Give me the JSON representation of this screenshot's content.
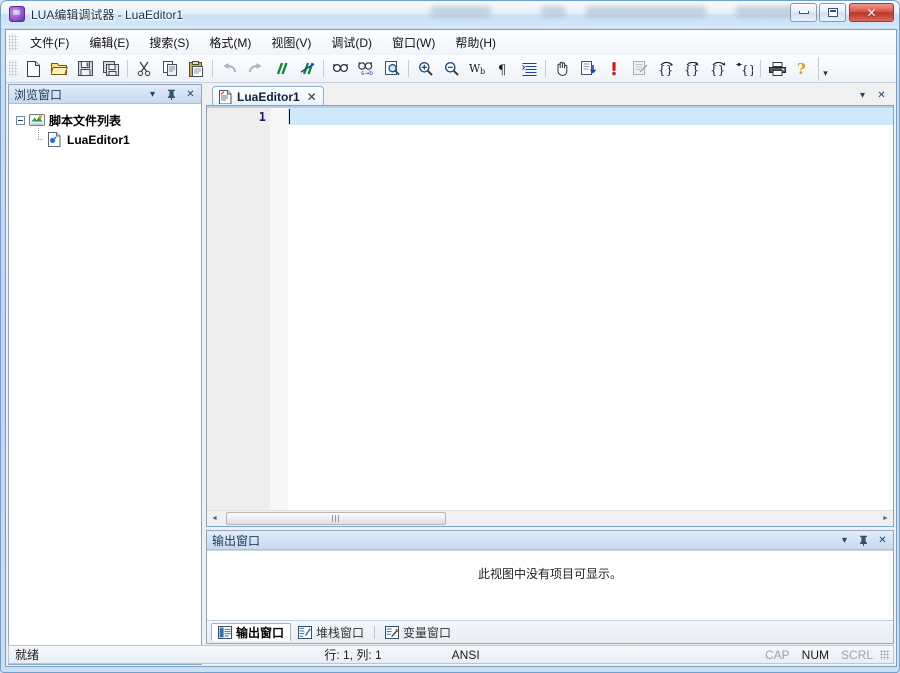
{
  "window": {
    "title": "LUA编辑调试器 - LuaEditor1",
    "app_icon": "lua-app-icon",
    "minimize_label": "",
    "maximize_label": "",
    "close_label": "✕"
  },
  "menubar": {
    "items": [
      {
        "label": "文件(F)",
        "name": "menu-file"
      },
      {
        "label": "编辑(E)",
        "name": "menu-edit"
      },
      {
        "label": "搜索(S)",
        "name": "menu-search"
      },
      {
        "label": "格式(M)",
        "name": "menu-format"
      },
      {
        "label": "视图(V)",
        "name": "menu-view"
      },
      {
        "label": "调试(D)",
        "name": "menu-debug"
      },
      {
        "label": "窗口(W)",
        "name": "menu-window"
      },
      {
        "label": "帮助(H)",
        "name": "menu-help"
      }
    ]
  },
  "toolbar": {
    "overflow_label": "▾",
    "buttons": [
      {
        "icon": "new-file-icon"
      },
      {
        "icon": "open-folder-icon"
      },
      {
        "icon": "save-icon"
      },
      {
        "icon": "save-all-icon"
      },
      {
        "icon": "separator"
      },
      {
        "icon": "cut-icon"
      },
      {
        "icon": "copy-icon"
      },
      {
        "icon": "paste-icon"
      },
      {
        "icon": "separator"
      },
      {
        "icon": "undo-icon"
      },
      {
        "icon": "redo-icon"
      },
      {
        "icon": "comment-icon"
      },
      {
        "icon": "uncomment-icon"
      },
      {
        "icon": "separator"
      },
      {
        "icon": "find-icon"
      },
      {
        "icon": "find-next-icon"
      },
      {
        "icon": "find-in-files-icon"
      },
      {
        "icon": "separator"
      },
      {
        "icon": "zoom-in-icon"
      },
      {
        "icon": "zoom-out-icon"
      },
      {
        "icon": "word-wrap-icon"
      },
      {
        "icon": "paragraph-marks-icon"
      },
      {
        "icon": "indent-guides-icon"
      },
      {
        "icon": "separator"
      },
      {
        "icon": "hand-pan-icon"
      },
      {
        "icon": "run-script-icon"
      },
      {
        "icon": "breakpoint-icon"
      },
      {
        "icon": "clear-breakpoints-icon"
      },
      {
        "icon": "step-over-icon"
      },
      {
        "icon": "step-into-icon"
      },
      {
        "icon": "step-out-icon"
      },
      {
        "icon": "run-to-cursor-icon"
      },
      {
        "icon": "separator"
      },
      {
        "icon": "print-icon"
      },
      {
        "icon": "help-icon"
      }
    ]
  },
  "browser_panel": {
    "title": "浏览窗口",
    "caption_buttons": [
      {
        "label": "▾",
        "name": "browser-panel-menu-button"
      },
      {
        "label": "⊥",
        "name": "browser-panel-pin-button"
      },
      {
        "label": "✕",
        "name": "browser-panel-close-button"
      }
    ],
    "tree": {
      "root": {
        "label": "脚本文件列表",
        "icon": "script-list-icon"
      },
      "children": [
        {
          "label": "LuaEditor1",
          "icon": "lua-file-icon"
        }
      ]
    }
  },
  "editor": {
    "tabs": [
      {
        "label": "LuaEditor1",
        "icon": "lua-document-icon",
        "close_label": "✕",
        "active": true
      }
    ],
    "tabstrip_buttons": [
      {
        "label": "▾",
        "name": "tabstrip-dropdown-button"
      },
      {
        "label": "✕",
        "name": "tabstrip-close-button"
      }
    ],
    "line_numbers": [
      "1"
    ],
    "content_lines": [
      ""
    ],
    "hscroll": {
      "left_arrow": "◄",
      "right_arrow": "►"
    }
  },
  "output_panel": {
    "title": "输出窗口",
    "caption_buttons": [
      {
        "label": "▾",
        "name": "output-panel-menu-button"
      },
      {
        "label": "⊥",
        "name": "output-panel-pin-button"
      },
      {
        "label": "✕",
        "name": "output-panel-close-button"
      }
    ],
    "empty_message": "此视图中没有项目可显示。",
    "tabs": [
      {
        "label": "输出窗口",
        "icon": "output-window-icon",
        "active": true
      },
      {
        "label": "堆栈窗口",
        "icon": "stack-window-icon",
        "active": false
      },
      {
        "label": "变量窗口",
        "icon": "variable-window-icon",
        "active": false
      }
    ]
  },
  "statusbar": {
    "message": "就绪",
    "caret_position": "行: 1, 列: 1",
    "encoding": "ANSI",
    "caps_lock": "CAP",
    "num_lock": "NUM",
    "scroll_lock": "SCRL"
  },
  "colors": {
    "title_text": "#1b3347",
    "accent_blue": "#7fa5c8",
    "current_line_highlight": "#cfe9fa",
    "close_button_red": "#b93528",
    "gutter_bg": "#eeeeee"
  }
}
